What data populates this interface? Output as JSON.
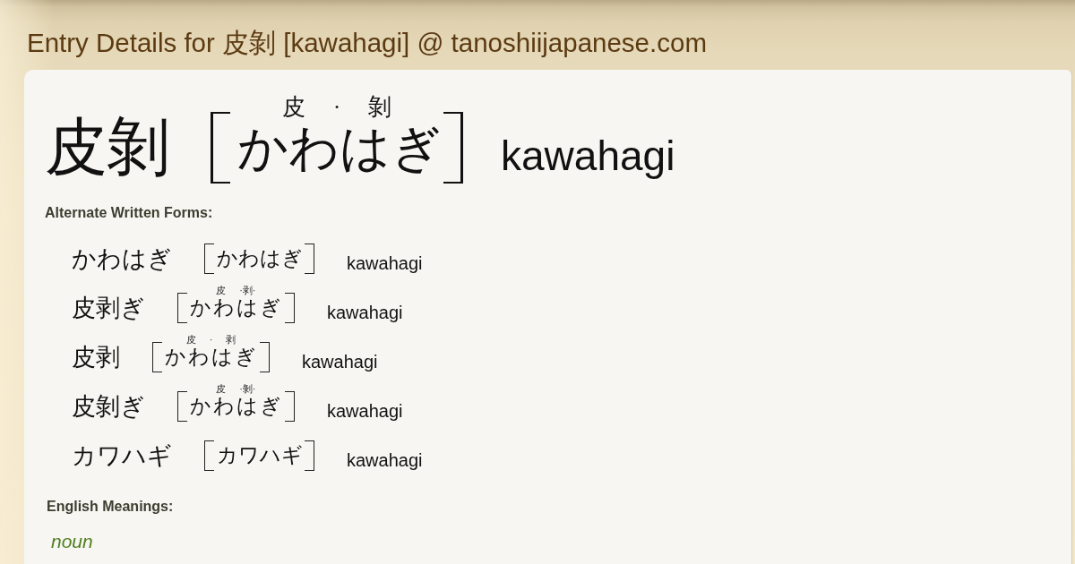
{
  "page_title": "Entry Details for 皮剝 [kawahagi] @ tanoshiijapanese.com",
  "entry": {
    "word": "皮剝",
    "furigana": "皮 · 剝",
    "reading": "かわはぎ",
    "romaji": "kawahagi"
  },
  "alternate_forms": {
    "heading": "Alternate Written Forms:",
    "items": [
      {
        "word": "かわはぎ",
        "reading": "かわはぎ",
        "romaji": "kawahagi"
      },
      {
        "word": "皮剥ぎ",
        "furigana": "皮 ·剥·",
        "reading": "かわはぎ",
        "romaji": "kawahagi"
      },
      {
        "word": "皮剥",
        "furigana": "皮 · 剥",
        "reading": "かわはぎ",
        "romaji": "kawahagi"
      },
      {
        "word": "皮剝ぎ",
        "furigana": "皮 ·剝·",
        "reading": "かわはぎ",
        "romaji": "kawahagi"
      },
      {
        "word": "カワハギ",
        "reading": "カワハギ",
        "romaji": "kawahagi"
      }
    ]
  },
  "english_meanings": {
    "heading": "English Meanings:",
    "part_of_speech": "noun"
  }
}
